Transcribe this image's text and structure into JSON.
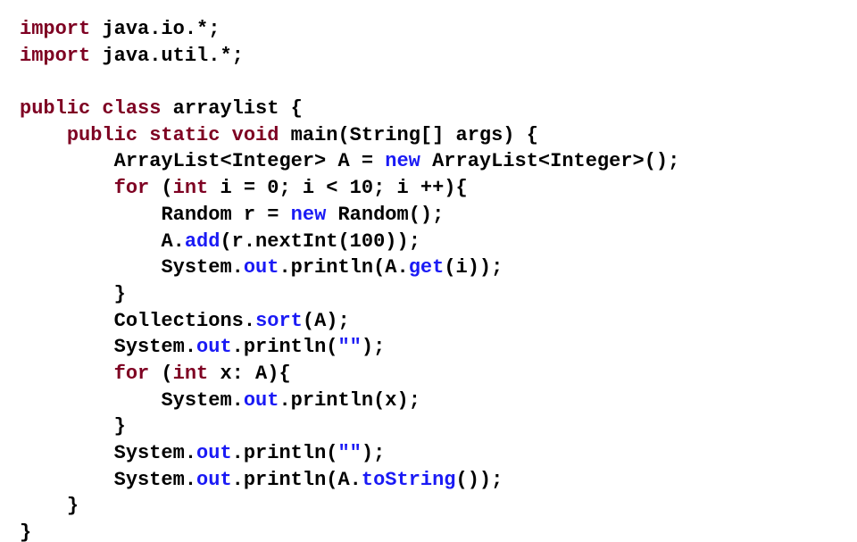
{
  "code": {
    "l01": {
      "a": "import",
      "b": " java.io.*;"
    },
    "l02": {
      "a": "import",
      "b": " java.util.*;"
    },
    "l03": {
      "a": "public",
      "b": " ",
      "c": "class",
      "d": " arraylist {"
    },
    "l04": {
      "a": "public",
      "b": " ",
      "c": "static",
      "d": " ",
      "e": "void",
      "f": " main(String[] args) {"
    },
    "l05": {
      "a": "ArrayList<Integer> A = ",
      "b": "new",
      "c": " ArrayList<Integer>();"
    },
    "l06": {
      "a": "for",
      "b": " (",
      "c": "int",
      "d": " i = 0; i < 10; i ++){"
    },
    "l07": {
      "a": "Random r = ",
      "b": "new",
      "c": " Random();"
    },
    "l08": {
      "a": "A.",
      "b": "add",
      "c": "(r.nextInt(100));"
    },
    "l09": {
      "a": "System.",
      "b": "out",
      "c": ".println(A.",
      "d": "get",
      "e": "(i));"
    },
    "l10": {
      "a": "}"
    },
    "l11": {
      "a": "Collections.",
      "b": "sort",
      "c": "(A);"
    },
    "l12": {
      "a": "System.",
      "b": "out",
      "c": ".println(",
      "d": "\"\"",
      "e": ");"
    },
    "l13": {
      "a": "for",
      "b": " (",
      "c": "int",
      "d": " x: A){"
    },
    "l14": {
      "a": "System.",
      "b": "out",
      "c": ".println(x);"
    },
    "l15": {
      "a": "}"
    },
    "l16": {
      "a": "System.",
      "b": "out",
      "c": ".println(",
      "d": "\"\"",
      "e": ");"
    },
    "l17": {
      "a": "System.",
      "b": "out",
      "c": ".println(A.",
      "d": "toString",
      "e": "());"
    },
    "l18": {
      "a": "}"
    },
    "l19": {
      "a": "}"
    }
  }
}
